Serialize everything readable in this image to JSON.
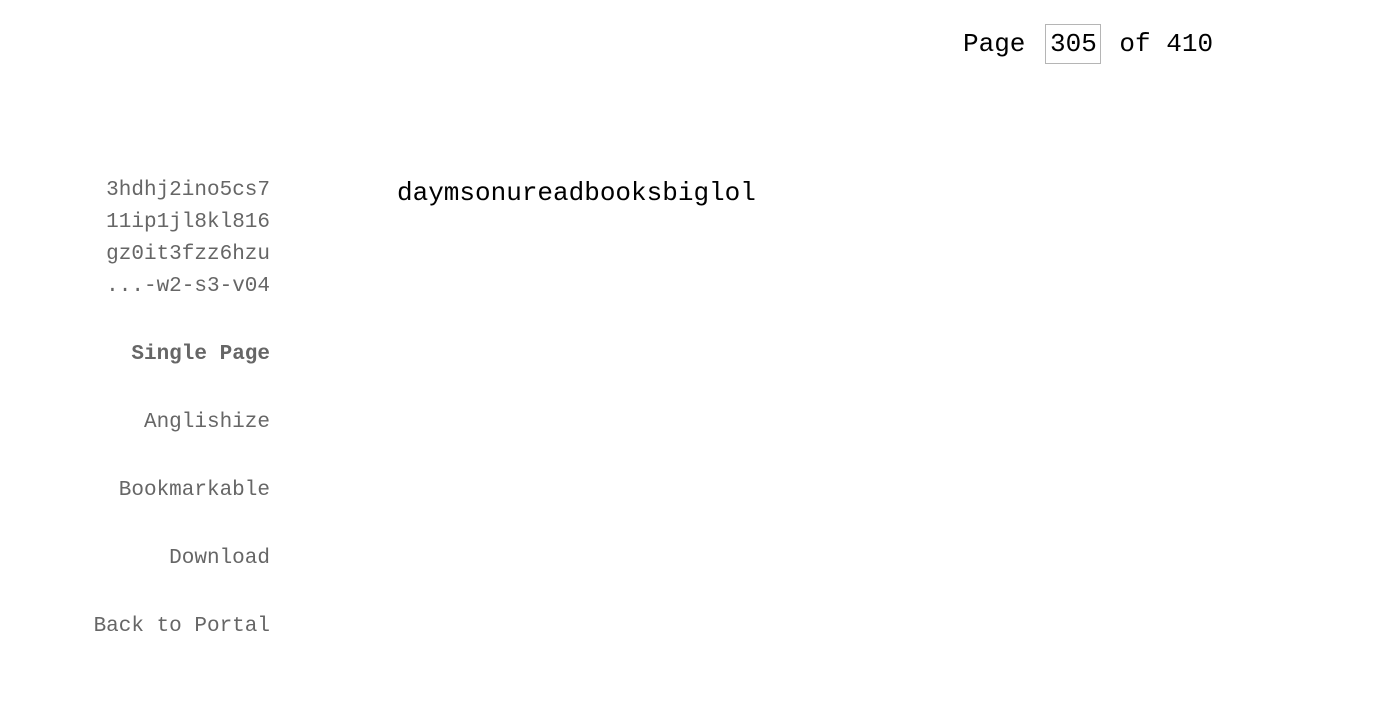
{
  "pager": {
    "page_label": "Page",
    "current_page": "305",
    "of_label": "of",
    "total_pages": "410"
  },
  "sidebar": {
    "hash_lines": [
      "3hdhj2ino5cs7",
      "11ip1jl8kl816",
      "gz0it3fzz6hzu",
      "...-w2-s3-v04"
    ],
    "menu": {
      "single_page": "Single Page",
      "anglishize": "Anglishize",
      "bookmarkable": "Bookmarkable",
      "download": "Download",
      "back_to_portal": "Back to Portal"
    }
  },
  "content": {
    "text": "daymsonureadbooksbiglol"
  },
  "colors": {
    "menu_text": "#666666",
    "content_text": "#000000",
    "input_border": "#b5b5b5",
    "background": "#ffffff"
  }
}
